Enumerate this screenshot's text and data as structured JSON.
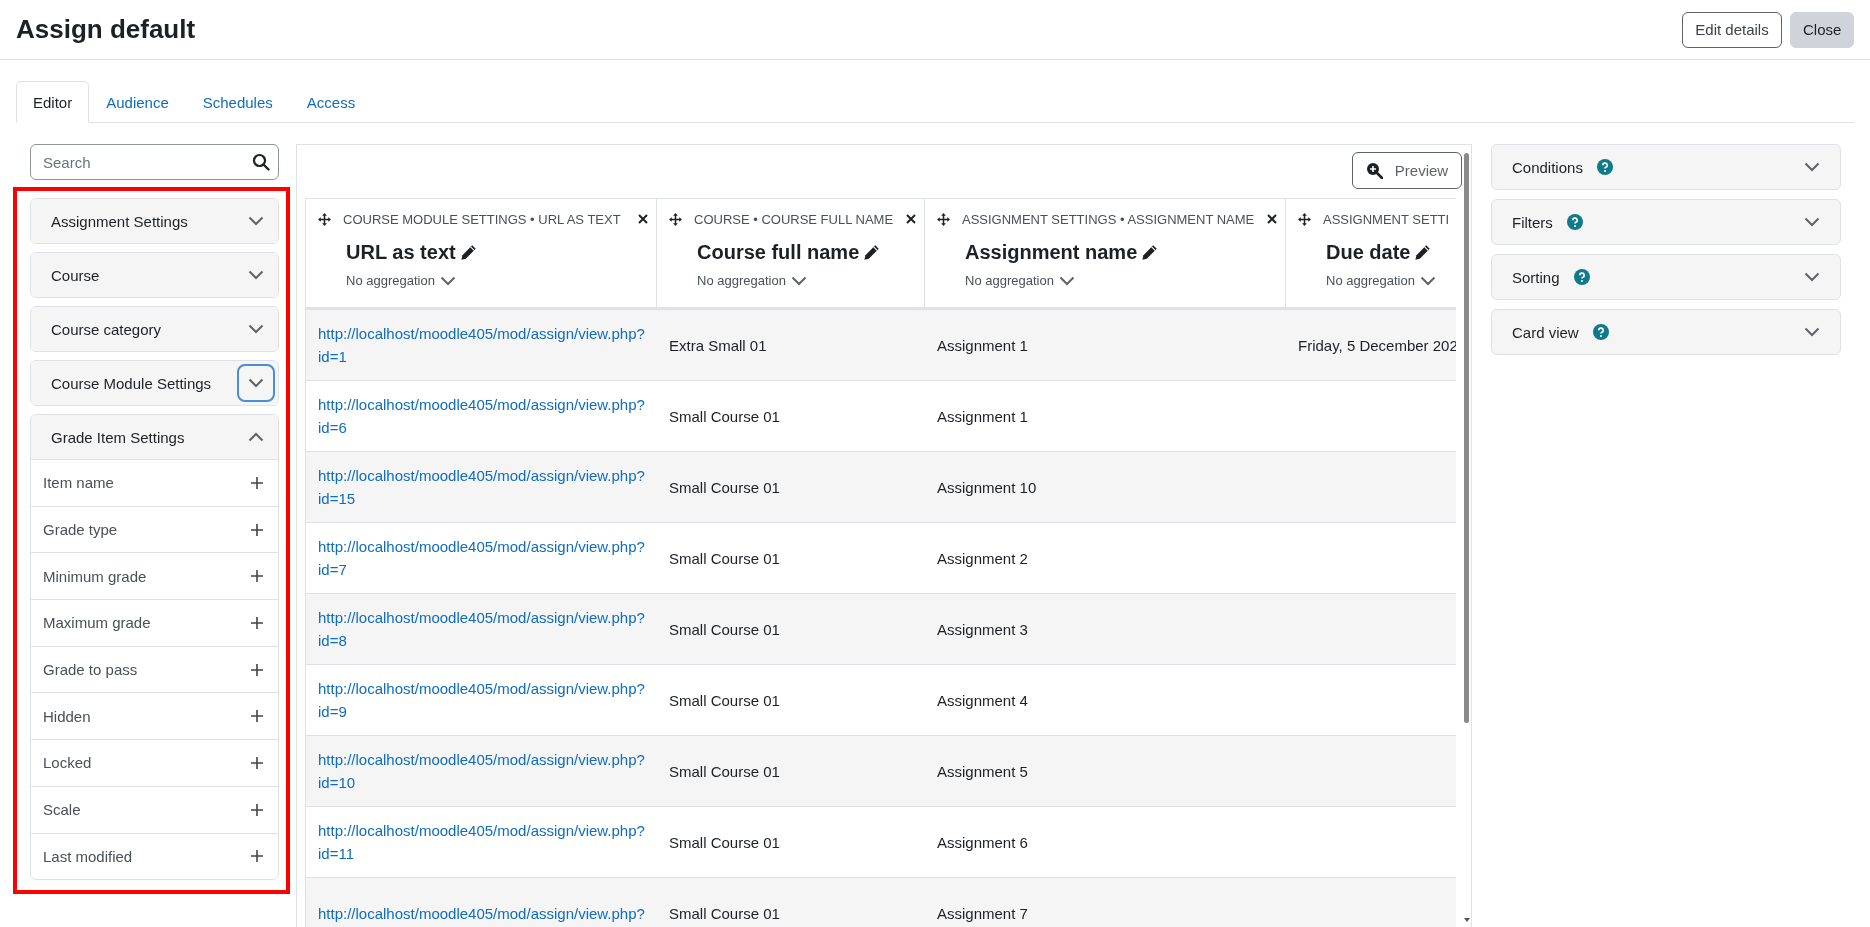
{
  "page": {
    "title": "Assign default",
    "actions": [
      {
        "label": "Edit details",
        "kind": "outline"
      },
      {
        "label": "Close",
        "kind": "secondary"
      }
    ]
  },
  "tabs": [
    {
      "label": "Editor",
      "selected": true
    },
    {
      "label": "Audience",
      "selected": false
    },
    {
      "label": "Schedules",
      "selected": false
    },
    {
      "label": "Access",
      "selected": false
    }
  ],
  "sidebar": {
    "search": {
      "placeholder": "Search"
    },
    "highlighted": true,
    "groups": [
      {
        "label": "Assignment Settings",
        "expanded": false,
        "focused": false
      },
      {
        "label": "Course",
        "expanded": false,
        "focused": false
      },
      {
        "label": "Course category",
        "expanded": false,
        "focused": false
      },
      {
        "label": "Course Module Settings",
        "expanded": false,
        "focused": true
      },
      {
        "label": "Grade Item Settings",
        "expanded": true,
        "focused": false,
        "items": [
          "Item name",
          "Grade type",
          "Minimum grade",
          "Maximum grade",
          "Grade to pass",
          "Hidden",
          "Locked",
          "Scale",
          "Last modified"
        ]
      }
    ]
  },
  "report": {
    "preview_button": "Preview",
    "columns": [
      {
        "source": "COURSE MODULE SETTINGS • URL AS TEXT",
        "title": "URL as text",
        "aggregation": "No aggregation",
        "kind": "link",
        "clipped": false
      },
      {
        "source": "COURSE • COURSE FULL NAME",
        "title": "Course full name",
        "aggregation": "No aggregation",
        "kind": "text",
        "clipped": false
      },
      {
        "source": "ASSIGNMENT SETTINGS • ASSIGNMENT NAME",
        "title": "Assignment name",
        "aggregation": "No aggregation",
        "kind": "text",
        "clipped": false
      },
      {
        "source": "ASSIGNMENT SETTI",
        "title": "Due date",
        "aggregation": "No aggregation",
        "kind": "text",
        "clipped": true
      }
    ],
    "rows": [
      {
        "cells": [
          "http://localhost/moodle405/mod/assign/view.php?id=1",
          "Extra Small 01",
          "Assignment 1",
          "Friday, 5 December 202"
        ]
      },
      {
        "cells": [
          "http://localhost/moodle405/mod/assign/view.php?id=6",
          "Small Course 01",
          "Assignment 1",
          ""
        ]
      },
      {
        "cells": [
          "http://localhost/moodle405/mod/assign/view.php?id=15",
          "Small Course 01",
          "Assignment 10",
          ""
        ]
      },
      {
        "cells": [
          "http://localhost/moodle405/mod/assign/view.php?id=7",
          "Small Course 01",
          "Assignment 2",
          ""
        ]
      },
      {
        "cells": [
          "http://localhost/moodle405/mod/assign/view.php?id=8",
          "Small Course 01",
          "Assignment 3",
          ""
        ]
      },
      {
        "cells": [
          "http://localhost/moodle405/mod/assign/view.php?id=9",
          "Small Course 01",
          "Assignment 4",
          ""
        ]
      },
      {
        "cells": [
          "http://localhost/moodle405/mod/assign/view.php?id=10",
          "Small Course 01",
          "Assignment 5",
          ""
        ]
      },
      {
        "cells": [
          "http://localhost/moodle405/mod/assign/view.php?id=11",
          "Small Course 01",
          "Assignment 6",
          ""
        ]
      },
      {
        "cells": [
          "http://localhost/moodle405/mod/assign/view.php?",
          "Small Course 01",
          "Assignment 7",
          ""
        ]
      }
    ]
  },
  "settings_panels": [
    {
      "label": "Conditions",
      "expanded": false
    },
    {
      "label": "Filters",
      "expanded": false
    },
    {
      "label": "Sorting",
      "expanded": false
    },
    {
      "label": "Card view",
      "expanded": false
    }
  ]
}
